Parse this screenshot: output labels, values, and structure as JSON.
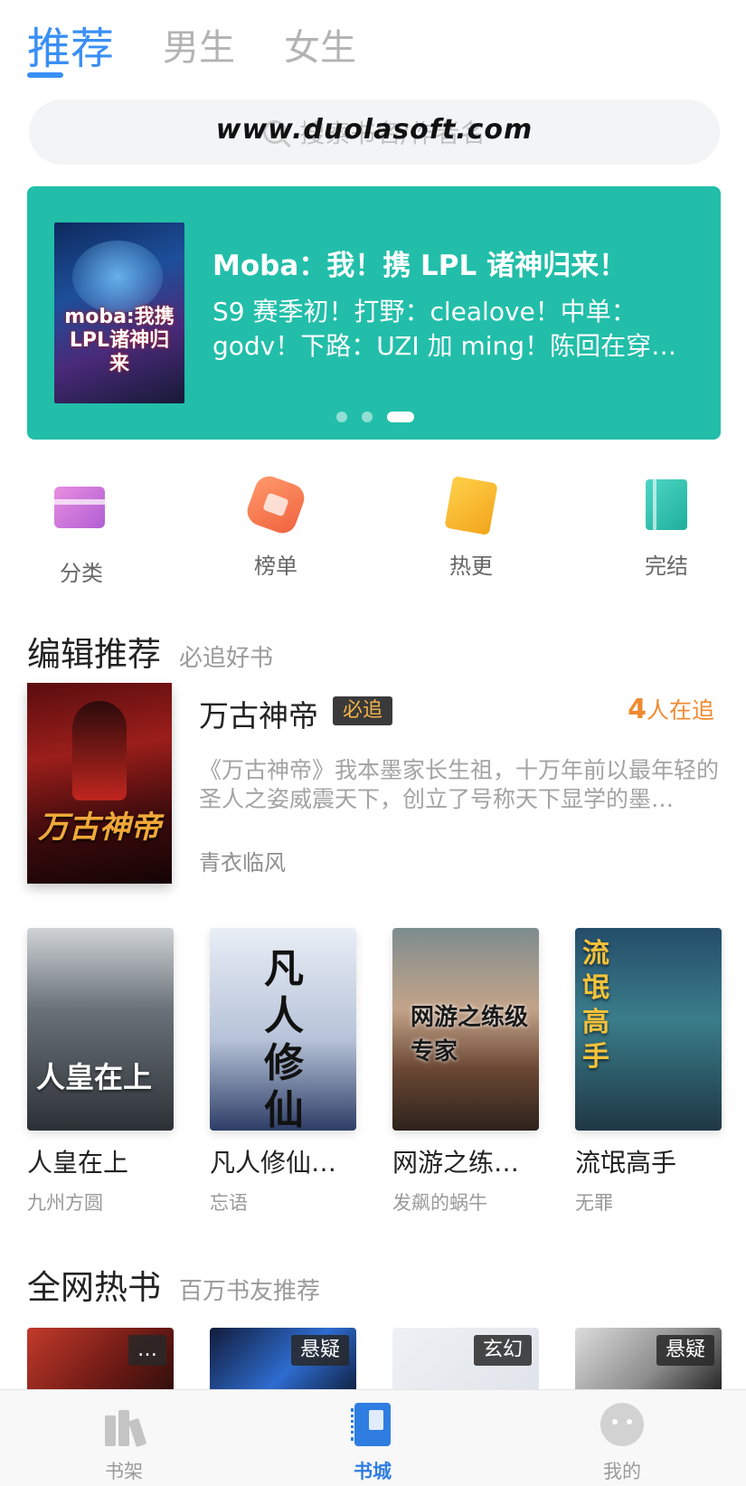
{
  "tabs": [
    {
      "label": "推荐",
      "active": true
    },
    {
      "label": "男生",
      "active": false
    },
    {
      "label": "女生",
      "active": false
    }
  ],
  "search": {
    "placeholder": "搜索书名/作者名",
    "watermark": "www.duolasoft.com"
  },
  "banner": {
    "cover_text": "moba:我携LPL诸神归来",
    "title": "Moba：我！携 LPL 诸神归来！",
    "description": "S9 赛季初！打野：clealove！中单：godv！下路：UZI 加 ming！陈回在穿…",
    "dots": 3,
    "active_dot": 2
  },
  "quick_menu": [
    {
      "label": "分类",
      "icon": "category-icon"
    },
    {
      "label": "榜单",
      "icon": "ranking-icon"
    },
    {
      "label": "热更",
      "icon": "hot-update-icon"
    },
    {
      "label": "完结",
      "icon": "completed-icon"
    }
  ],
  "editor_section": {
    "title": "编辑推荐",
    "subtitle": "必追好书"
  },
  "featured_book": {
    "title": "万古神帝",
    "badge": "必追",
    "readers_num": "4",
    "readers_suffix": "人在追",
    "description": "《万古神帝》我本墨家长生祖，十万年前以最年轻的圣人之姿威震天下，创立了号称天下显学的墨…",
    "author": "青衣临风",
    "cover_text": "万古神帝"
  },
  "book_grid": [
    {
      "title": "人皇在上",
      "author": "九州方圆",
      "cover_text": "人皇在上"
    },
    {
      "title": "凡人修仙…",
      "author": "忘语",
      "cover_text": "凡人修仙"
    },
    {
      "title": "网游之练…",
      "author": "发飙的蜗牛",
      "cover_text": "网游之练级专家"
    },
    {
      "title": "流氓高手",
      "author": "无罪",
      "cover_text": "流氓高手"
    }
  ],
  "hot_section": {
    "title": "全网热书",
    "subtitle": "百万书友推荐"
  },
  "hot_books": [
    {
      "tag": "…"
    },
    {
      "tag": "悬疑"
    },
    {
      "tag": "玄幻"
    },
    {
      "tag": "悬疑"
    }
  ],
  "bottom_nav": [
    {
      "label": "书架",
      "active": false
    },
    {
      "label": "书城",
      "active": true
    },
    {
      "label": "我的",
      "active": false
    }
  ],
  "colors": {
    "accent": "#3a8ff5",
    "banner_bg": "#22bea9",
    "readers": "#f08a30"
  }
}
